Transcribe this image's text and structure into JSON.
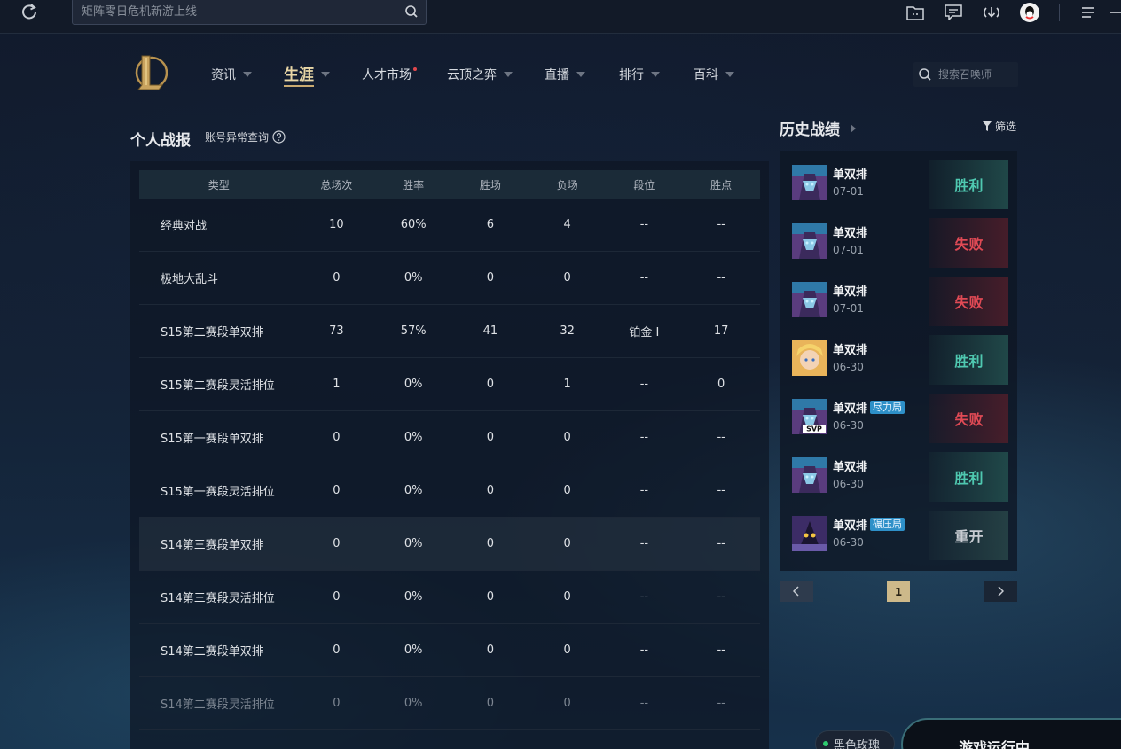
{
  "topbar": {
    "search_placeholder": "矩阵零日危机新游上线",
    "icons": [
      "refresh-icon",
      "search-icon",
      "folder-icon",
      "message-icon",
      "download-icon",
      "qq-avatar-icon",
      "menu-icon",
      "minimize-icon"
    ]
  },
  "nav": {
    "items": [
      {
        "label": "资讯",
        "caret": true
      },
      {
        "label": "生涯",
        "caret": true,
        "active": true
      },
      {
        "label": "人才市场",
        "caret": false,
        "dot": true
      },
      {
        "label": "云顶之弈",
        "caret": true
      },
      {
        "label": "直播",
        "caret": true
      },
      {
        "label": "排行",
        "caret": true
      },
      {
        "label": "百科",
        "caret": true
      }
    ],
    "search_placeholder": "搜索召唤师"
  },
  "stats": {
    "title": "个人战报",
    "sub_link": "账号异常查询",
    "headers": [
      "类型",
      "总场次",
      "胜率",
      "胜场",
      "负场",
      "段位",
      "胜点"
    ],
    "rows": [
      [
        "经典对战",
        "10",
        "60%",
        "6",
        "4",
        "--",
        "--"
      ],
      [
        "极地大乱斗",
        "0",
        "0%",
        "0",
        "0",
        "--",
        "--"
      ],
      [
        "S15第二赛段单双排",
        "73",
        "57%",
        "41",
        "32",
        "铂金 Ⅰ",
        "17"
      ],
      [
        "S15第二赛段灵活排位",
        "1",
        "0%",
        "0",
        "1",
        "--",
        "0"
      ],
      [
        "S15第一赛段单双排",
        "0",
        "0%",
        "0",
        "0",
        "--",
        "--"
      ],
      [
        "S15第一赛段灵活排位",
        "0",
        "0%",
        "0",
        "0",
        "--",
        "--"
      ],
      [
        "S14第三赛段单双排",
        "0",
        "0%",
        "0",
        "0",
        "--",
        "--"
      ],
      [
        "S14第三赛段灵活排位",
        "0",
        "0%",
        "0",
        "0",
        "--",
        "--"
      ],
      [
        "S14第二赛段单双排",
        "0",
        "0%",
        "0",
        "0",
        "--",
        "--"
      ],
      [
        "S14第二赛段灵活排位",
        "0",
        "0%",
        "0",
        "0",
        "--",
        "--"
      ]
    ]
  },
  "history": {
    "title": "历史战绩",
    "filter_label": "筛选",
    "matches": [
      {
        "type": "单双排",
        "date": "07-01",
        "result": "胜利",
        "kind": "win",
        "tag": "",
        "avatar": "purple"
      },
      {
        "type": "单双排",
        "date": "07-01",
        "result": "失败",
        "kind": "loss",
        "tag": "",
        "avatar": "purple"
      },
      {
        "type": "单双排",
        "date": "07-01",
        "result": "失败",
        "kind": "loss",
        "tag": "",
        "avatar": "purple"
      },
      {
        "type": "单双排",
        "date": "06-30",
        "result": "胜利",
        "kind": "win",
        "tag": "",
        "avatar": "blonde"
      },
      {
        "type": "单双排",
        "date": "06-30",
        "result": "失败",
        "kind": "loss",
        "tag": "尽力局",
        "avatar": "purple",
        "badge": "SVP"
      },
      {
        "type": "单双排",
        "date": "06-30",
        "result": "胜利",
        "kind": "win",
        "tag": "",
        "avatar": "purple"
      },
      {
        "type": "单双排",
        "date": "06-30",
        "result": "重开",
        "kind": "remake",
        "tag": "碾压局",
        "avatar": "dark"
      }
    ],
    "page": "1"
  },
  "footer": {
    "friend_label": "黑色玫瑰",
    "game_status": "游戏运行中"
  },
  "colors": {
    "accent_gold": "#c9aa71",
    "win": "#4fc8b0",
    "loss": "#e04a55",
    "tag_blue": "#2e90c8"
  }
}
